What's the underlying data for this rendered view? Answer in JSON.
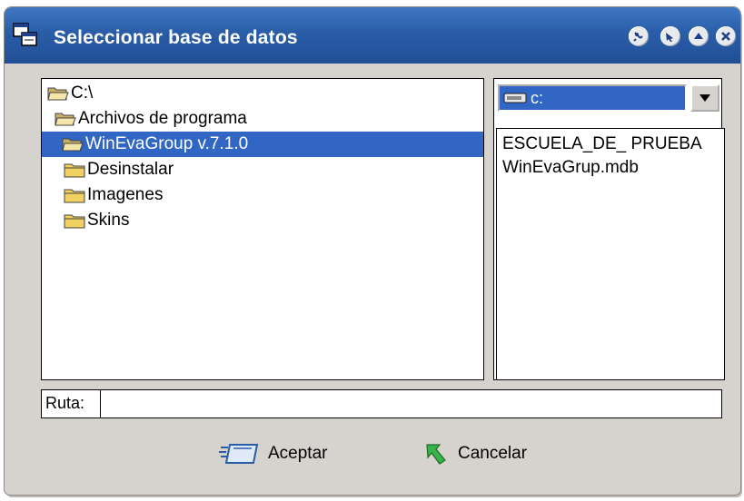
{
  "window": {
    "title": "Seleccionar base de datos",
    "title_buttons": [
      "help-icon",
      "pin-icon",
      "maximize-icon",
      "close-icon"
    ]
  },
  "tree": {
    "items": [
      {
        "label": "C:\\",
        "icon": "open-folder-icon",
        "selected": false
      },
      {
        "label": "Archivos de programa",
        "icon": "open-folder-icon",
        "selected": false
      },
      {
        "label": "WinEvaGroup v.7.1.0",
        "icon": "open-folder-icon",
        "selected": true
      },
      {
        "label": "Desinstalar",
        "icon": "folder-icon",
        "selected": false
      },
      {
        "label": "Imagenes",
        "icon": "folder-icon",
        "selected": false
      },
      {
        "label": "Skins",
        "icon": "folder-icon",
        "selected": false
      }
    ]
  },
  "drive": {
    "selected": "c:",
    "icon": "drive-icon"
  },
  "files": {
    "items": [
      "ESCUELA_DE_ PRUEBA",
      "WinEvaGrup.mdb"
    ]
  },
  "path": {
    "label": "Ruta:",
    "value": ""
  },
  "buttons": {
    "accept_label": "Aceptar",
    "cancel_label": "Cancelar"
  }
}
